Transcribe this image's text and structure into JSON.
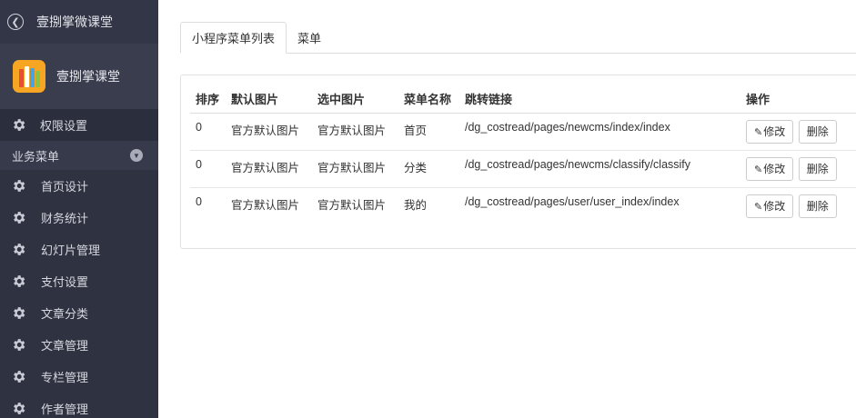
{
  "sidebar": {
    "title": "壹捌掌微课堂",
    "brand": "壹捌掌课堂",
    "permission": "权限设置",
    "section": "业务菜单",
    "items": [
      {
        "label": "首页设计"
      },
      {
        "label": "财务统计"
      },
      {
        "label": "幻灯片管理"
      },
      {
        "label": "支付设置"
      },
      {
        "label": "文章分类"
      },
      {
        "label": "文章管理"
      },
      {
        "label": "专栏管理"
      },
      {
        "label": "作者管理"
      }
    ]
  },
  "tabs": [
    {
      "label": "小程序菜单列表",
      "active": true
    },
    {
      "label": "菜单",
      "active": false
    }
  ],
  "table": {
    "headers": {
      "order": "排序",
      "default_img": "默认图片",
      "selected_img": "选中图片",
      "name": "菜单名称",
      "link": "跳转链接",
      "ops": "操作"
    },
    "rows": [
      {
        "order": "0",
        "default_img": "官方默认图片",
        "selected_img": "官方默认图片",
        "name": "首页",
        "link": "/dg_costread/pages/newcms/index/index"
      },
      {
        "order": "0",
        "default_img": "官方默认图片",
        "selected_img": "官方默认图片",
        "name": "分类",
        "link": "/dg_costread/pages/newcms/classify/classify"
      },
      {
        "order": "0",
        "default_img": "官方默认图片",
        "selected_img": "官方默认图片",
        "name": "我的",
        "link": "/dg_costread/pages/user/user_index/index"
      }
    ],
    "edit_label": "修改",
    "delete_label": "删除"
  },
  "colors": {
    "sidebar_bg": "#2f3241",
    "logo_bg": "#f6a623"
  }
}
